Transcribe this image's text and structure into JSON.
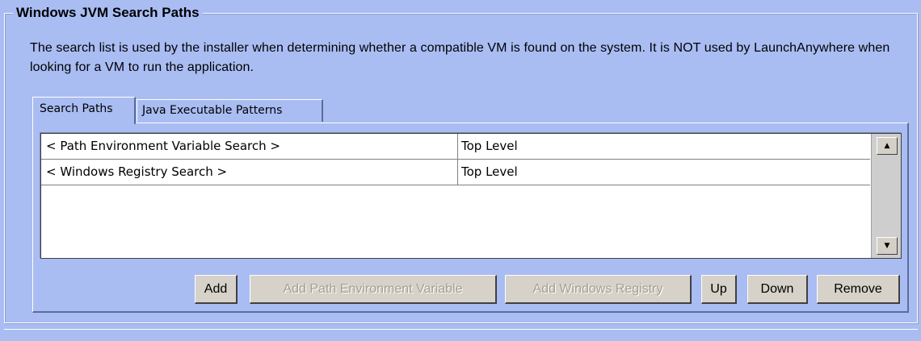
{
  "group": {
    "title": "Windows JVM Search Paths",
    "description": "The search list is used by the installer when determining whether a compatible VM is found on the system. It is NOT used by LaunchAnywhere when looking for a VM to run the application."
  },
  "tabs": [
    {
      "label": "Search Paths",
      "selected": true
    },
    {
      "label": "Java Executable Patterns",
      "selected": false
    }
  ],
  "table": {
    "rows": [
      {
        "path": "< Path Environment Variable Search >",
        "level": "Top Level"
      },
      {
        "path": "< Windows Registry Search >",
        "level": "Top Level"
      }
    ],
    "scrollbar": {
      "up_icon": "arrow-up",
      "down_icon": "arrow-down"
    }
  },
  "buttons": {
    "add": {
      "label": "Add",
      "enabled": true
    },
    "add_path_env": {
      "label": "Add Path Environment Variable",
      "enabled": false
    },
    "add_windows_registry": {
      "label": "Add Windows Registry",
      "enabled": false
    },
    "up": {
      "label": "Up",
      "enabled": true
    },
    "down": {
      "label": "Down",
      "enabled": true
    },
    "remove": {
      "label": "Remove",
      "enabled": true
    }
  },
  "colors": {
    "background": "#a9bdf3",
    "button_face": "#d6d2c9",
    "disabled_text": "#a49e93"
  }
}
